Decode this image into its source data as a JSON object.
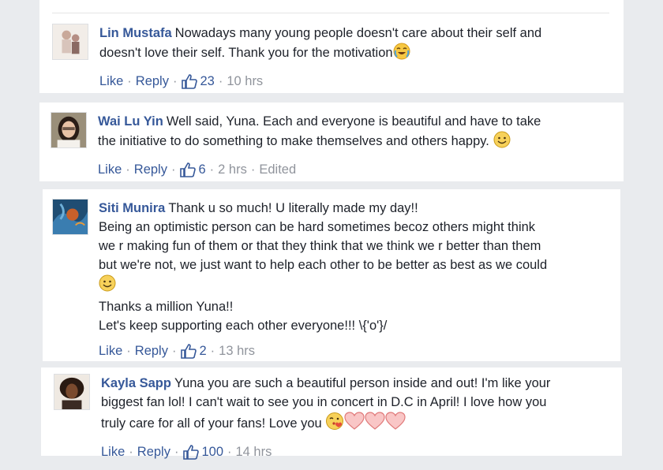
{
  "comments": [
    {
      "name": "Lin Mustafa",
      "lines": [
        "Nowadays many young people doesn't care about their self and",
        "doesn't love their self. Thank you for the motivation"
      ],
      "actions": {
        "like": "Like",
        "reply": "Reply",
        "likes": "23",
        "time": "10 hrs"
      }
    },
    {
      "name": "Wai Lu Yin",
      "lines": [
        "Well said, Yuna. Each and everyone is beautiful and have to take",
        "the initiative to do something to make themselves and others happy."
      ],
      "actions": {
        "like": "Like",
        "reply": "Reply",
        "likes": "6",
        "time": "2 hrs",
        "edited": "Edited"
      }
    },
    {
      "name": "Siti Munira",
      "lines": [
        "Thank u so much! U literally made my day!!",
        "Being an optimistic person can be hard sometimes becoz others might think",
        "we r making fun of them or that they think that we think we r better than them",
        "but we're not, we just want to help each other to be better as best as we could",
        "",
        "Thanks a million Yuna!!",
        "Let's keep supporting each other everyone!!! \\{'o'}/"
      ],
      "actions": {
        "like": "Like",
        "reply": "Reply",
        "likes": "2",
        "time": "13 hrs"
      }
    },
    {
      "name": "Kayla Sapp",
      "lines": [
        "Yuna you are such a beautiful person inside and out! I'm like your",
        "biggest fan lol! I can't wait to see you in concert in D.C in April! I love how you",
        "truly care for all of your fans! Love you"
      ],
      "actions": {
        "like": "Like",
        "reply": "Reply",
        "likes": "100",
        "time": "14 hrs"
      }
    }
  ],
  "icons": {
    "like_count_icon": "thumbs-up-icon",
    "emojis": [
      "crying-laughing-emoji",
      "smile-emoji",
      "smile-emoji",
      "kiss-wink-emoji",
      "heart-emoji"
    ]
  },
  "colors": {
    "name": "#365899",
    "text": "#1d2129",
    "meta": "#90949c",
    "background": "#e9ebee",
    "card": "#ffffff"
  }
}
